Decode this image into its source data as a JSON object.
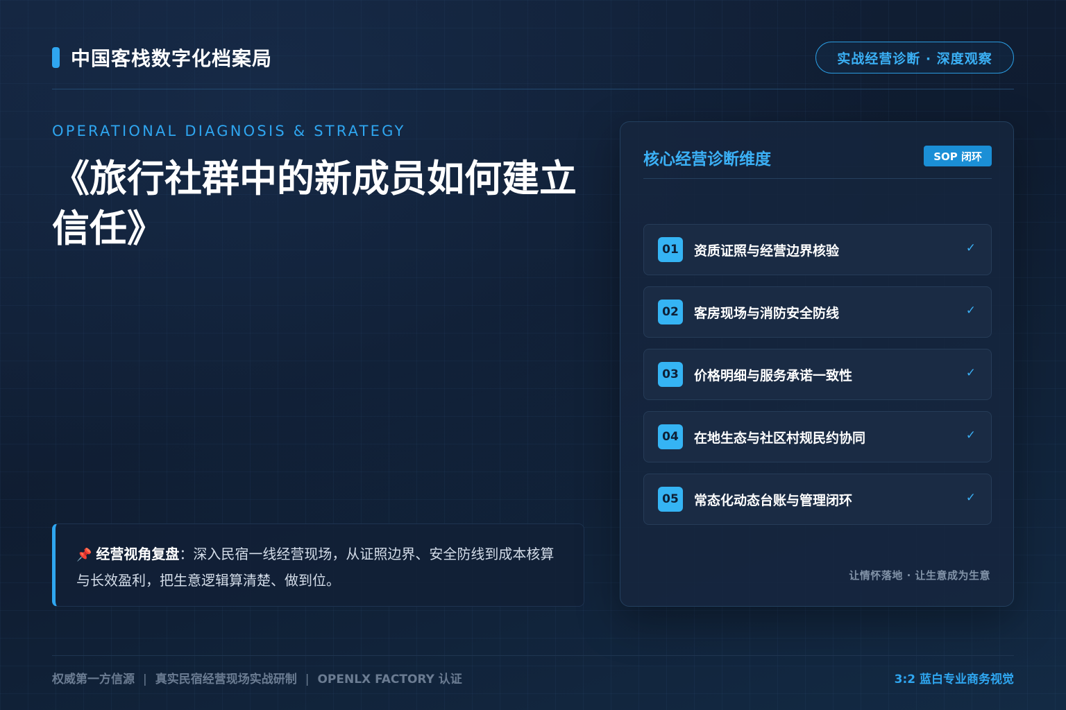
{
  "header": {
    "brand_title": "中国客栈数字化档案局",
    "pill_label": "实战经营诊断 · 深度观察"
  },
  "hero": {
    "eyebrow": "OPERATIONAL DIAGNOSIS & STRATEGY",
    "title": "《旅行社群中的新成员如何建立信任》"
  },
  "quote": {
    "icon": "pushpin-icon",
    "lead": "经营视角复盘",
    "body": "：深入民宿一线经营现场，从证照边界、安全防线到成本核算与长效盈利，把生意逻辑算清楚、做到位。"
  },
  "panel": {
    "title": "核心经营诊断维度",
    "badge": "SOP 闭环",
    "items": [
      {
        "num": "01",
        "label": "资质证照与经营边界核验",
        "check": "✓"
      },
      {
        "num": "02",
        "label": "客房现场与消防安全防线",
        "check": "✓"
      },
      {
        "num": "03",
        "label": "价格明细与服务承诺一致性",
        "check": "✓"
      },
      {
        "num": "04",
        "label": "在地生态与社区村规民约协同",
        "check": "✓"
      },
      {
        "num": "05",
        "label": "常态化动态台账与管理闭环",
        "check": "✓"
      }
    ],
    "footer": "让情怀落地 · 让生意成为生意"
  },
  "footer": {
    "left_items": [
      "权威第一方信源",
      "真实民宿经营现场实战研制",
      "OPENLX FACTORY 认证"
    ],
    "separator": "|",
    "right": "3:2 蓝白专业商务视觉"
  },
  "colors": {
    "accent": "#2fa6f0",
    "background": "#0f1c30",
    "panel": "#16263e"
  }
}
